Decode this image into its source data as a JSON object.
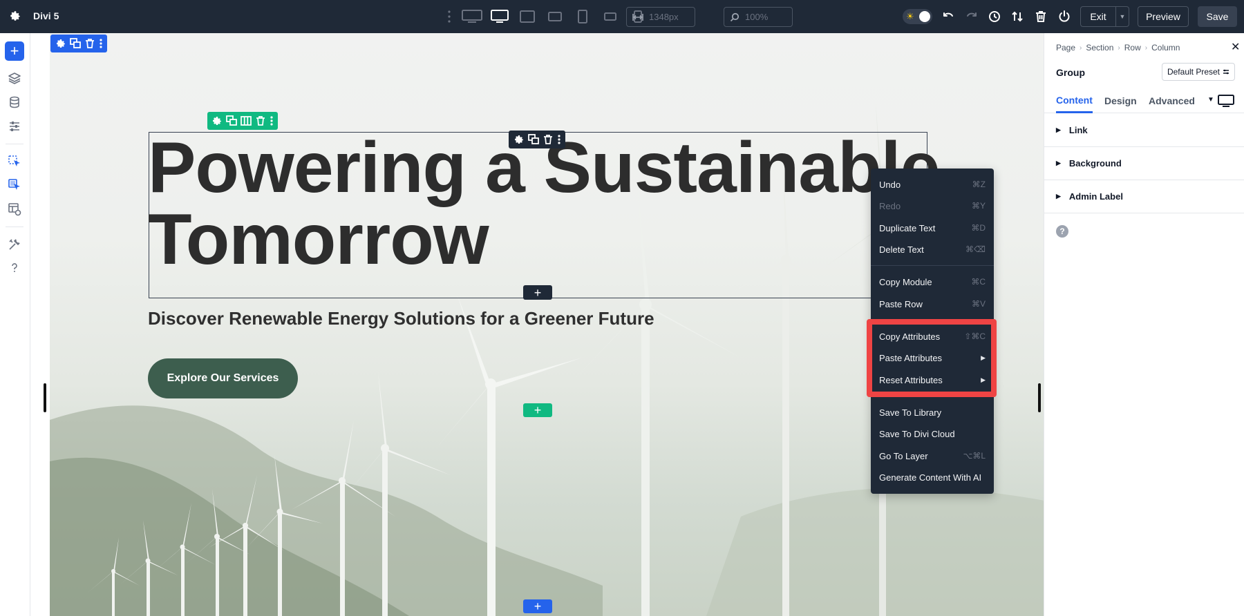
{
  "app": {
    "title": "Divi 5"
  },
  "toolbar": {
    "width_value": "1348px",
    "zoom_value": "100%",
    "exit_label": "Exit",
    "preview_label": "Preview",
    "save_label": "Save"
  },
  "hero": {
    "headline": "Powering a Sustainable Tomorrow",
    "subheadline": "Discover Renewable Energy Solutions for a Greener Future",
    "cta_label": "Explore Our Services"
  },
  "context_menu": {
    "items": [
      {
        "label": "Undo",
        "shortcut": "⌘Z"
      },
      {
        "label": "Redo",
        "shortcut": "⌘Y"
      },
      {
        "label": "Duplicate Text",
        "shortcut": "⌘D"
      },
      {
        "label": "Delete Text",
        "shortcut": "⌘⌫"
      },
      {
        "label": "Copy Module",
        "shortcut": "⌘C"
      },
      {
        "label": "Paste Row",
        "shortcut": "⌘V"
      },
      {
        "label": "Copy Attributes",
        "shortcut": "⇧⌘C"
      },
      {
        "label": "Paste Attributes",
        "shortcut": "▶"
      },
      {
        "label": "Reset Attributes",
        "shortcut": "▶"
      },
      {
        "label": "Save To Library",
        "shortcut": ""
      },
      {
        "label": "Save To Divi Cloud",
        "shortcut": ""
      },
      {
        "label": "Go To Layer",
        "shortcut": "⌥⌘L"
      },
      {
        "label": "Generate Content With AI",
        "shortcut": ""
      }
    ]
  },
  "panel": {
    "breadcrumb": [
      "Page",
      "Section",
      "Row",
      "Column"
    ],
    "title": "Group",
    "preset_label": "Default Preset",
    "tabs": [
      "Content",
      "Design",
      "Advanced"
    ],
    "sections": [
      "Link",
      "Background",
      "Admin Label"
    ]
  },
  "colors": {
    "topbar": "#1f2937",
    "accent_blue": "#2563eb",
    "accent_green": "#10b981",
    "cta_green": "#3d5e4e",
    "highlight_red": "#ef4444"
  },
  "icons": [
    "gear-icon",
    "kebab-icon",
    "desktop-wide-icon",
    "desktop-icon",
    "tablet-landscape-icon",
    "tablet-icon",
    "phone-landscape-icon",
    "phone-icon",
    "width-icon",
    "zoom-icon",
    "undo-icon",
    "redo-icon",
    "history-icon",
    "sort-icon",
    "trash-icon",
    "power-icon",
    "plus-icon",
    "layers-icon",
    "database-icon",
    "sliders-icon",
    "pointer-icon",
    "multi-pointer-icon",
    "layout-icon",
    "wrench-icon",
    "question-icon",
    "close-icon",
    "monitor-icon"
  ]
}
